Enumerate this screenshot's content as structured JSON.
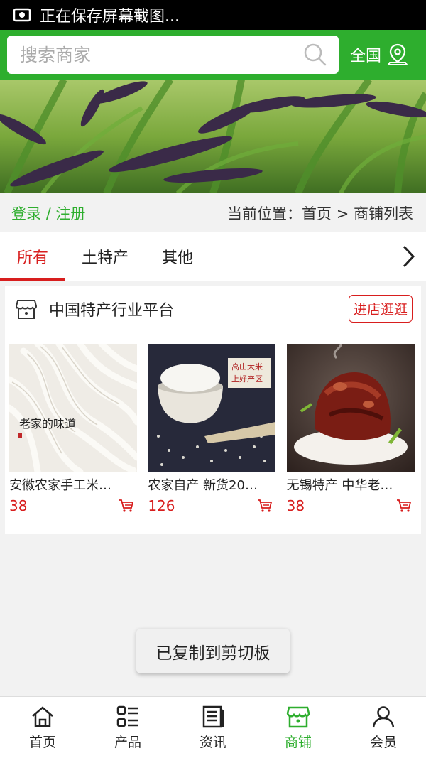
{
  "status_bar": {
    "text": "正在保存屏幕截图..."
  },
  "header": {
    "search_placeholder": "搜索商家",
    "region_label": "全国"
  },
  "breadcrumb_row": {
    "login_label": "登录 / 注册",
    "current_position": "当前位置：首页 > 商铺列表"
  },
  "tabs": [
    {
      "label": "所有",
      "active": true
    },
    {
      "label": "土特产",
      "active": false
    },
    {
      "label": "其他",
      "active": false
    }
  ],
  "shop": {
    "name": "中国特产行业平台",
    "visit_button": "进店逛逛",
    "products": [
      {
        "title": "安徽农家手工米…",
        "price": "38"
      },
      {
        "title": "农家自产 新货20…",
        "price": "126"
      },
      {
        "title": "无锡特产 中华老…",
        "price": "38"
      }
    ],
    "product_image_texts": {
      "noodle_calligraphy": "老家的味道",
      "rice_sign": [
        "高山大米",
        "上好产区"
      ]
    }
  },
  "toast": {
    "text": "已复制到剪切板"
  },
  "bottom_nav": [
    {
      "label": "首页",
      "icon": "home-icon",
      "active": false
    },
    {
      "label": "产品",
      "icon": "list-icon",
      "active": false
    },
    {
      "label": "资讯",
      "icon": "news-icon",
      "active": false
    },
    {
      "label": "商铺",
      "icon": "store-icon",
      "active": true
    },
    {
      "label": "会员",
      "icon": "user-icon",
      "active": false
    }
  ],
  "colors": {
    "brand_green": "#2eae2e",
    "accent_red": "#d81e1e"
  }
}
